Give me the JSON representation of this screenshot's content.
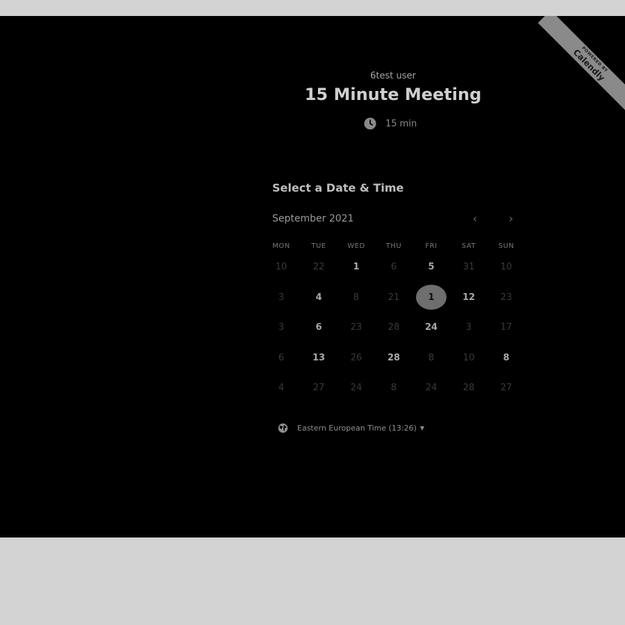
{
  "badge": {
    "powered_text": "POWERED BY",
    "brand_text": "Calendly"
  },
  "event": {
    "owner": "6test user",
    "title": "15 Minute Meeting",
    "duration": "15 min",
    "duration_icon": "clock-icon"
  },
  "scheduler": {
    "section_title": "Select a Date & Time",
    "month_label": "September 2021",
    "prev_icon": "chevron-left-icon",
    "next_icon": "chevron-right-icon",
    "weekdays": [
      "MON",
      "TUE",
      "WED",
      "THU",
      "FRI",
      "SAT",
      "SUN"
    ],
    "weeks": [
      [
        {
          "label": "10",
          "state": "disabled"
        },
        {
          "label": "22",
          "state": "disabled"
        },
        {
          "label": "1",
          "state": "available"
        },
        {
          "label": "6",
          "state": "disabled"
        },
        {
          "label": "5",
          "state": "available"
        },
        {
          "label": "31",
          "state": "disabled"
        },
        {
          "label": "10",
          "state": "disabled"
        }
      ],
      [
        {
          "label": "3",
          "state": "disabled"
        },
        {
          "label": "4",
          "state": "available"
        },
        {
          "label": "8",
          "state": "disabled"
        },
        {
          "label": "21",
          "state": "disabled"
        },
        {
          "label": "1",
          "state": "selected"
        },
        {
          "label": "12",
          "state": "available"
        },
        {
          "label": "23",
          "state": "disabled"
        }
      ],
      [
        {
          "label": "3",
          "state": "disabled"
        },
        {
          "label": "6",
          "state": "available"
        },
        {
          "label": "23",
          "state": "disabled"
        },
        {
          "label": "28",
          "state": "disabled"
        },
        {
          "label": "24",
          "state": "available"
        },
        {
          "label": "3",
          "state": "disabled"
        },
        {
          "label": "17",
          "state": "disabled"
        }
      ],
      [
        {
          "label": "6",
          "state": "disabled"
        },
        {
          "label": "13",
          "state": "available"
        },
        {
          "label": "26",
          "state": "disabled"
        },
        {
          "label": "28",
          "state": "available"
        },
        {
          "label": "8",
          "state": "disabled"
        },
        {
          "label": "10",
          "state": "disabled"
        },
        {
          "label": "8",
          "state": "available"
        }
      ],
      [
        {
          "label": "4",
          "state": "disabled"
        },
        {
          "label": "27",
          "state": "disabled"
        },
        {
          "label": "24",
          "state": "disabled"
        },
        {
          "label": "8",
          "state": "disabled"
        },
        {
          "label": "24",
          "state": "disabled"
        },
        {
          "label": "28",
          "state": "disabled"
        },
        {
          "label": "27",
          "state": "disabled"
        }
      ]
    ]
  },
  "timezone": {
    "label": "Eastern European Time (13:26)",
    "icon": "globe-icon",
    "dropdown_icon": "caret-down-icon"
  },
  "colors": {
    "panel_background": "#000000",
    "page_background": "#d3d3d3",
    "selected_day": "#6e6e6e",
    "badge": "#8a8a8a"
  }
}
